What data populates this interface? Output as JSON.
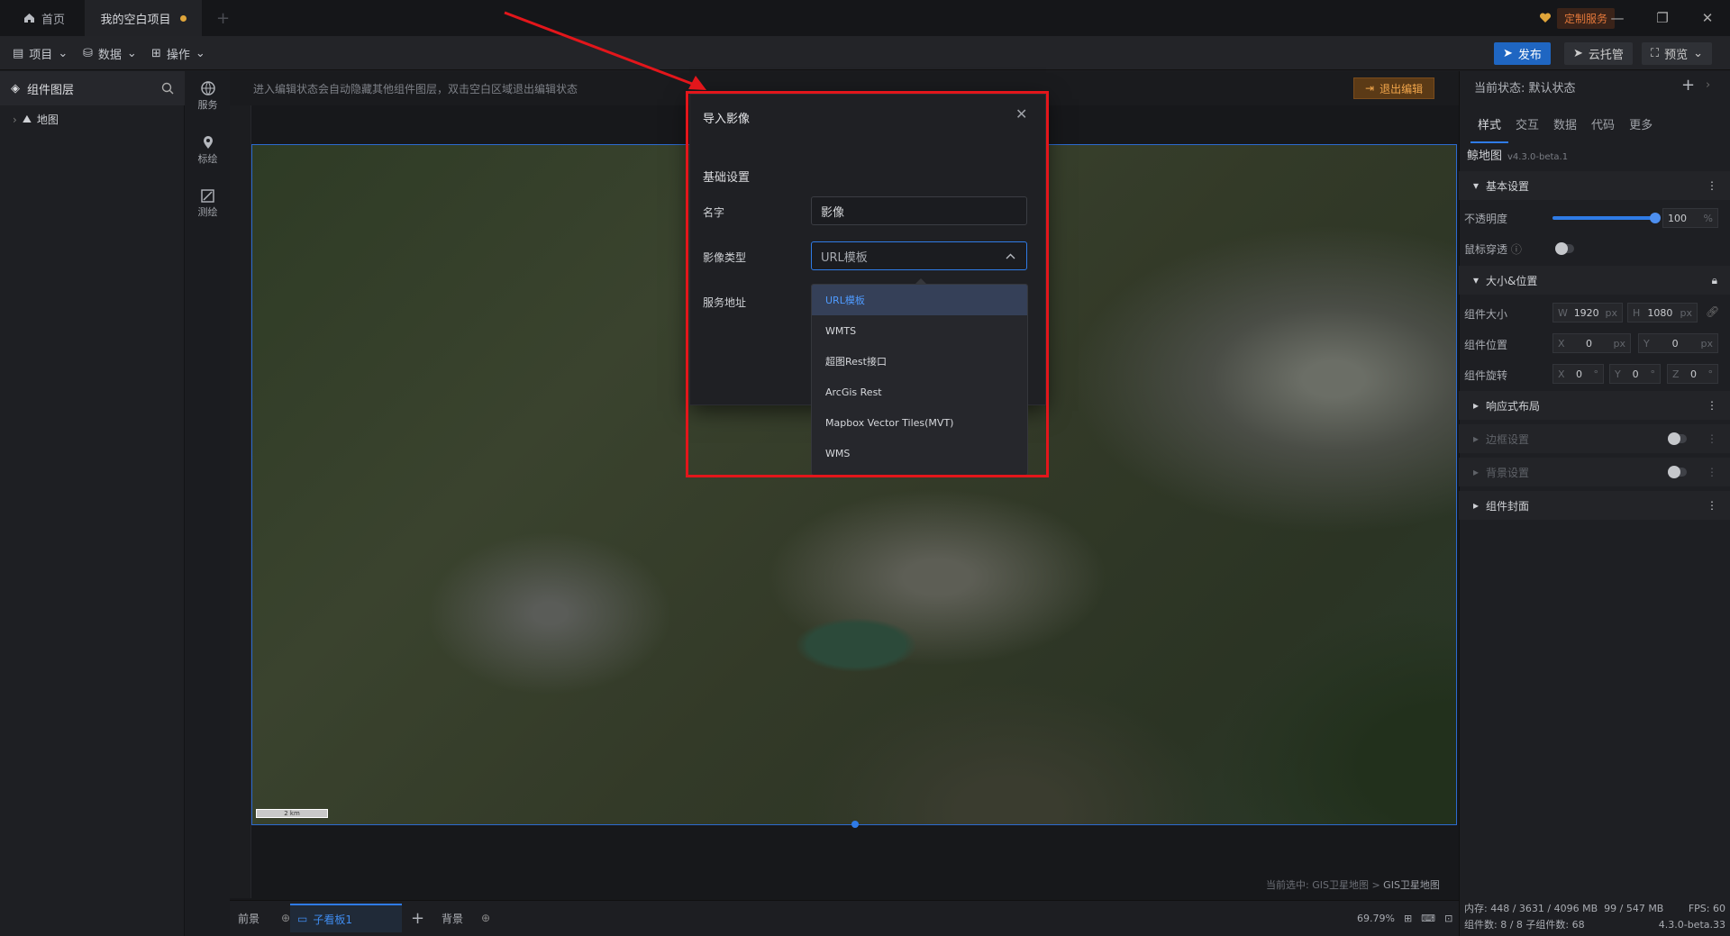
{
  "tabs": {
    "home": "首页",
    "project": "我的空白项目"
  },
  "custom_service": "定制服务",
  "toolbar": {
    "menu_project": "项目",
    "menu_data": "数据",
    "menu_ops": "操作",
    "publish": "发布",
    "cloud": "云托管",
    "preview": "预览"
  },
  "layers": {
    "title": "组件图层",
    "items": [
      {
        "label": "地图"
      }
    ]
  },
  "side_tools": [
    {
      "label": "服务",
      "icon": "globe-icon"
    },
    {
      "label": "标绘",
      "icon": "pin-icon"
    },
    {
      "label": "测绘",
      "icon": "measure-icon"
    }
  ],
  "hint": "进入编辑状态会自动隐藏其他组件图层，双击空白区域退出编辑状态",
  "exit_edit": "退出编辑",
  "map": {
    "scale_label": "2 km"
  },
  "selection_path": {
    "prefix": "当前选中: GIS卫星地图 > ",
    "current": "GIS卫星地图"
  },
  "bottom": {
    "front": "前景",
    "child": "子看板1",
    "back": "背景",
    "zoom": "69.79%"
  },
  "right": {
    "state_label": "当前状态: 默认状态",
    "tabs": [
      "样式",
      "交互",
      "数据",
      "代码",
      "更多"
    ],
    "component_name": "鲸地图",
    "version": "v4.3.0-beta.1",
    "sections": {
      "basic": "基本设置",
      "size_pos": "大小&位置",
      "responsive": "响应式布局",
      "border": "边框设置",
      "background": "背景设置",
      "cover": "组件封面"
    },
    "opacity_label": "不透明度",
    "opacity_value": "100",
    "opacity_unit": "%",
    "opacity_level": 1.0,
    "mouse_through": "鼠标穿透",
    "size_label": "组件大小",
    "w": "1920",
    "h": "1080",
    "pos_label": "组件位置",
    "x": "0",
    "y": "0",
    "rot_label": "组件旋转",
    "rx": "0",
    "ry": "0",
    "rz": "0",
    "unit_px": "px",
    "unit_deg": "°"
  },
  "status": {
    "memory": "内存: 448 / 3631 / 4096 MB",
    "mem2": "99 / 547 MB",
    "fps": "FPS:  60",
    "counts": "组件数: 8 / 8   子组件数: 68",
    "version": "4.3.0-beta.33"
  },
  "modal": {
    "title": "导入影像",
    "section": "基础设置",
    "name_label": "名字",
    "name_value": "影像",
    "type_label": "影像类型",
    "type_value": "URL模板",
    "url_label": "服务地址",
    "options": [
      "URL模板",
      "WMTS",
      "超图Rest接口",
      "ArcGis Rest",
      "Mapbox Vector Tiles(MVT)",
      "WMS"
    ]
  },
  "colors": {
    "accent": "#2f7be6",
    "highlight": "#e3161b",
    "publish": "#1f66c2"
  }
}
